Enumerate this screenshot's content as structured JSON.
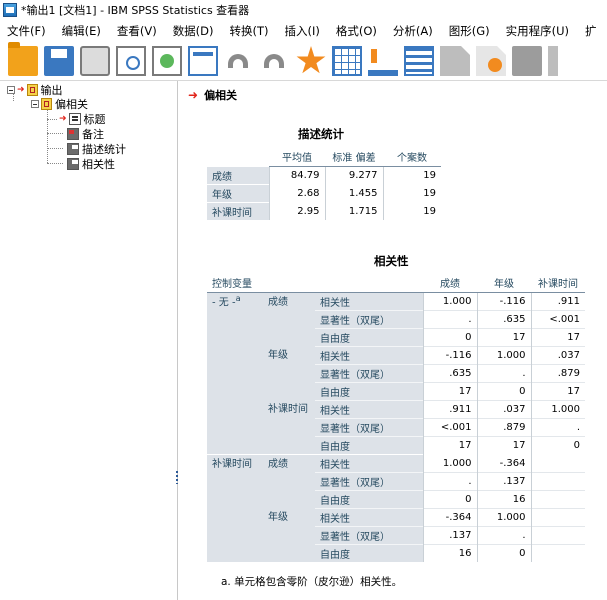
{
  "window": {
    "title": "*输出1 [文档1] - IBM SPSS Statistics 查看器"
  },
  "menu": [
    "文件(F)",
    "编辑(E)",
    "查看(V)",
    "数据(D)",
    "转换(T)",
    "插入(I)",
    "格式(O)",
    "分析(A)",
    "图形(G)",
    "实用程序(U)",
    "扩"
  ],
  "toolbar_icons": [
    "open-folder-icon",
    "save-icon",
    "print-icon",
    "print-preview-icon",
    "export-icon",
    "recall-dialog-icon",
    "undo-icon",
    "redo-icon",
    "goto-data-icon",
    "goto-case-icon",
    "variables-icon",
    "split-file-icon",
    "designate-window-icon",
    "run-script-icon",
    "gray-square-icon",
    "cut-icon"
  ],
  "tree": {
    "root": "输出",
    "group": "偏相关",
    "items": [
      "标题",
      "备注",
      "描述统计",
      "相关性"
    ]
  },
  "content": {
    "heading": "偏相关",
    "descriptive": {
      "title": "描述统计",
      "headers": [
        "平均值",
        "标准 偏差",
        "个案数"
      ],
      "rows": [
        {
          "label": "成绩",
          "values": [
            "84.79",
            "9.277",
            "19"
          ]
        },
        {
          "label": "年级",
          "values": [
            "2.68",
            "1.455",
            "19"
          ]
        },
        {
          "label": "补课时间",
          "values": [
            "2.95",
            "1.715",
            "19"
          ]
        }
      ]
    },
    "correlations": {
      "title": "相关性",
      "control_header": "控制变量",
      "headers": [
        "成绩",
        "年级",
        "补课时间"
      ],
      "stat_labels": [
        "相关性",
        "显著性（双尾）",
        "自由度"
      ],
      "controls": [
        {
          "name": "- 无 -",
          "superscript": "a",
          "vars": [
            {
              "name": "成绩",
              "rows": [
                [
                  "1.000",
                  "-.116",
                  ".911"
                ],
                [
                  ".",
                  ".635",
                  "<.001"
                ],
                [
                  "0",
                  "17",
                  "17"
                ]
              ]
            },
            {
              "name": "年级",
              "rows": [
                [
                  "-.116",
                  "1.000",
                  ".037"
                ],
                [
                  ".635",
                  ".",
                  ".879"
                ],
                [
                  "17",
                  "0",
                  "17"
                ]
              ]
            },
            {
              "name": "补课时间",
              "rows": [
                [
                  ".911",
                  ".037",
                  "1.000"
                ],
                [
                  "<.001",
                  ".879",
                  "."
                ],
                [
                  "17",
                  "17",
                  "0"
                ]
              ]
            }
          ]
        },
        {
          "name": "补课时间",
          "superscript": "",
          "vars": [
            {
              "name": "成绩",
              "rows": [
                [
                  "1.000",
                  "-.364",
                  ""
                ],
                [
                  ".",
                  ".137",
                  ""
                ],
                [
                  "0",
                  "16",
                  ""
                ]
              ]
            },
            {
              "name": "年级",
              "rows": [
                [
                  "-.364",
                  "1.000",
                  ""
                ],
                [
                  ".137",
                  ".",
                  ""
                ],
                [
                  "16",
                  "0",
                  ""
                ]
              ]
            }
          ]
        }
      ],
      "footnote": "a. 单元格包含零阶（皮尔逊）相关性。"
    }
  }
}
